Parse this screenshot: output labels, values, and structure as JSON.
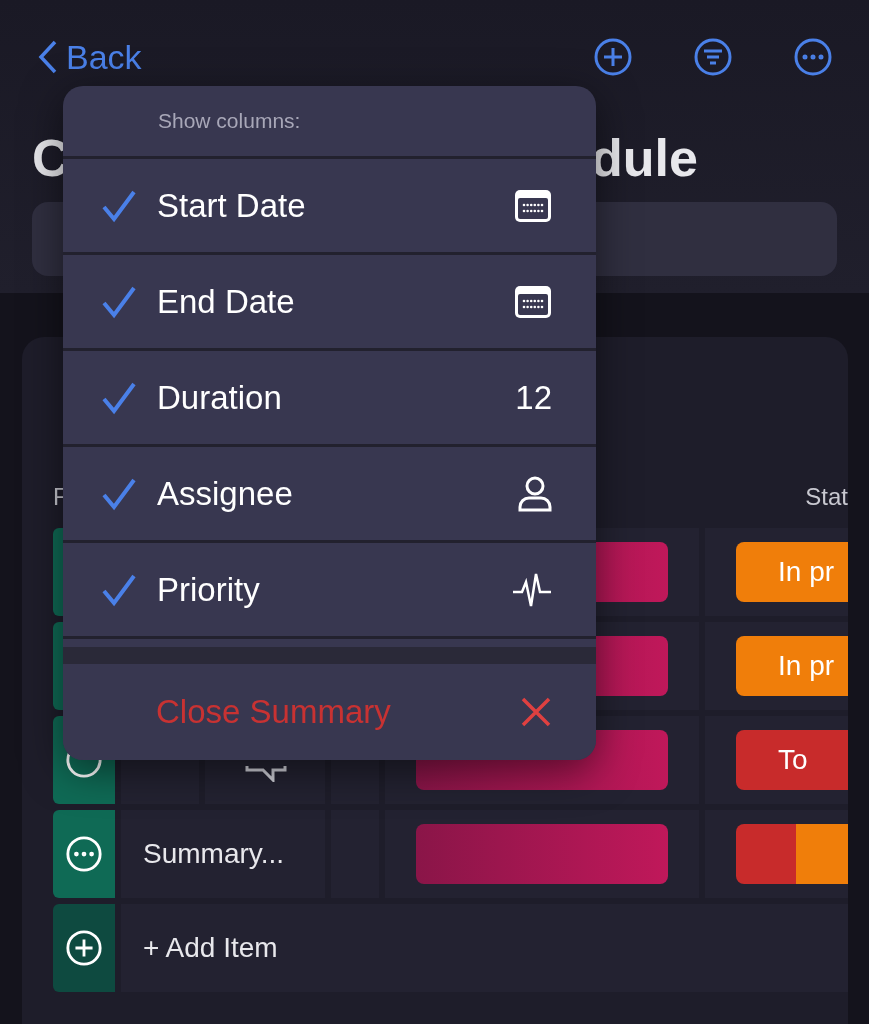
{
  "nav": {
    "back": "Back"
  },
  "title": {
    "start": "C",
    "end": "dule"
  },
  "columns": [
    "F",
    "Stat"
  ],
  "rows": [
    {
      "kind": "item",
      "status": [
        {
          "label": "In pr",
          "color": "#f07e0a"
        }
      ]
    },
    {
      "kind": "item",
      "status": [
        {
          "label": "In pr",
          "color": "#f07e0a"
        }
      ]
    },
    {
      "kind": "item",
      "comment": true,
      "status": [
        {
          "label": "To",
          "color": "#c82b2b"
        }
      ]
    },
    {
      "kind": "summary",
      "name": "Summary...",
      "status": [
        {
          "color": "#c82b2b"
        },
        {
          "color": "#f07e0a"
        }
      ]
    },
    {
      "kind": "add",
      "name": "+ Add Item"
    }
  ],
  "menu": {
    "title": "Show columns:",
    "options": [
      {
        "label": "Start Date",
        "checked": true,
        "kind": "calendar"
      },
      {
        "label": "End Date",
        "checked": true,
        "kind": "calendar"
      },
      {
        "label": "Duration",
        "checked": true,
        "kind": "number",
        "value": "12"
      },
      {
        "label": "Assignee",
        "checked": true,
        "kind": "person"
      },
      {
        "label": "Priority",
        "checked": true,
        "kind": "pulse"
      }
    ],
    "close": "Close Summary"
  }
}
